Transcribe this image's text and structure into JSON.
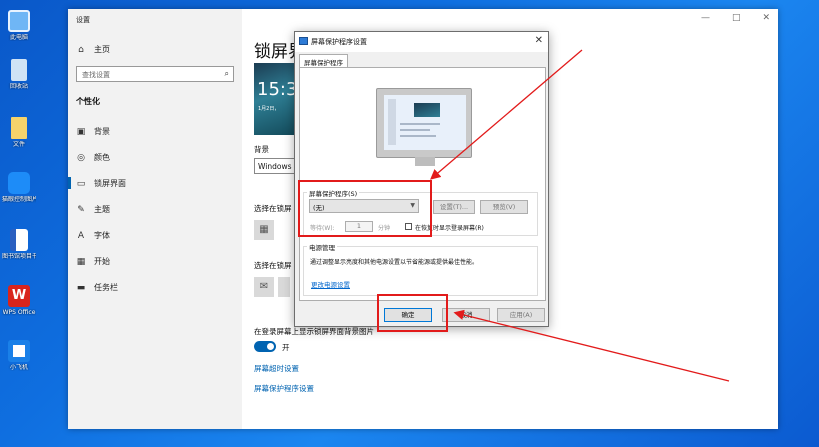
{
  "desktop": {
    "icons": [
      {
        "label": "此电脑",
        "icon": "computer-icon",
        "color": "#6fb6f5"
      },
      {
        "label": "回收站",
        "icon": "recycle-bin-icon",
        "color": "#cfe3f5"
      },
      {
        "label": "文件",
        "icon": "folder-icon",
        "color": "#f6d36b"
      },
      {
        "label": "猫眼控制图片搜索",
        "icon": "owl-app-icon",
        "color": "#1d8cf8"
      },
      {
        "label": "图书馆项目书",
        "icon": "document-icon",
        "color": "#2b5fc0"
      },
      {
        "label": "WPS Office",
        "icon": "wps-icon",
        "color": "#d9241c"
      },
      {
        "label": "小飞机",
        "icon": "app-icon",
        "color": "#1a80e8"
      }
    ]
  },
  "settings": {
    "window_title": "设置",
    "controls": {
      "minimize": "—",
      "maximize": "□",
      "close": "✕"
    },
    "home_label": "主页",
    "search_placeholder": "查找设置",
    "section": "个性化",
    "nav": [
      {
        "label": "背景",
        "icon": "picture-icon",
        "glyph": "▣"
      },
      {
        "label": "颜色",
        "icon": "palette-icon",
        "glyph": "◎"
      },
      {
        "label": "锁屏界面",
        "icon": "lock-screen-icon",
        "glyph": "▭"
      },
      {
        "label": "主题",
        "icon": "theme-icon",
        "glyph": "✎"
      },
      {
        "label": "字体",
        "icon": "font-icon",
        "glyph": "A"
      },
      {
        "label": "开始",
        "icon": "start-icon",
        "glyph": "▦"
      },
      {
        "label": "任务栏",
        "icon": "taskbar-icon",
        "glyph": "▬"
      }
    ],
    "main": {
      "page_title": "锁屏界",
      "preview_time": "15:3",
      "preview_date": "1月2日，",
      "background_label": "背景",
      "background_value": "Windows",
      "choose_app_label": "选择在锁屏",
      "choose_status_label": "选择在锁屏",
      "show_bg_label": "在登录屏幕上显示锁屏界面背景图片",
      "toggle_label": "开",
      "link_timeout": "屏幕超时设置",
      "link_screensaver": "屏幕保护程序设置"
    }
  },
  "dialog": {
    "title": "屏幕保护程序设置",
    "close": "✕",
    "tab": "屏幕保护程序",
    "group_screensaver": "屏幕保护程序(S)",
    "combo_value": "(无)",
    "settings_button": "设置(T)...",
    "preview_button": "预览(V)",
    "wait_label": "等待(W):",
    "wait_value": "1",
    "minutes_label": "分钟",
    "resume_label": "在恢复时显示登录屏幕(R)",
    "group_power": "电源管理",
    "power_text": "通过调整显示亮度和其他电源设置以节省能源或提供最佳性能。",
    "power_link": "更改电源设置",
    "ok": "确定",
    "cancel": "取消",
    "apply": "应用(A)"
  },
  "annotation_color": "#e21b1b"
}
